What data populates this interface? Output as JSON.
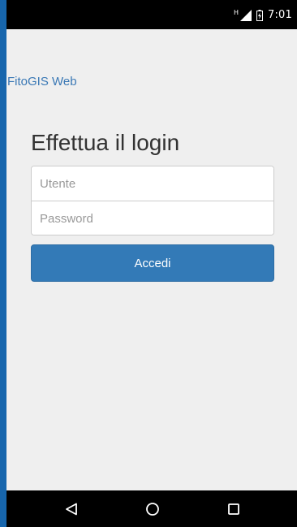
{
  "status_bar": {
    "network_badge": "H",
    "time": "7:01",
    "icons": [
      "signal-icon",
      "battery-icon"
    ]
  },
  "header": {
    "brand": "FitoGIS Web"
  },
  "login": {
    "title": "Effettua il login",
    "username_placeholder": "Utente",
    "username_value": "",
    "password_placeholder": "Password",
    "password_value": "",
    "submit_label": "Accedi"
  },
  "nav_bar": {
    "buttons": [
      "back-icon",
      "home-icon",
      "recents-icon"
    ]
  },
  "colors": {
    "status_bar_bg": "#000000",
    "page_bg": "#efefef",
    "brand_link": "#3a78b5",
    "primary_button": "#337ab7",
    "nav_bar_bg": "#000000",
    "frame": "#1766ad"
  }
}
